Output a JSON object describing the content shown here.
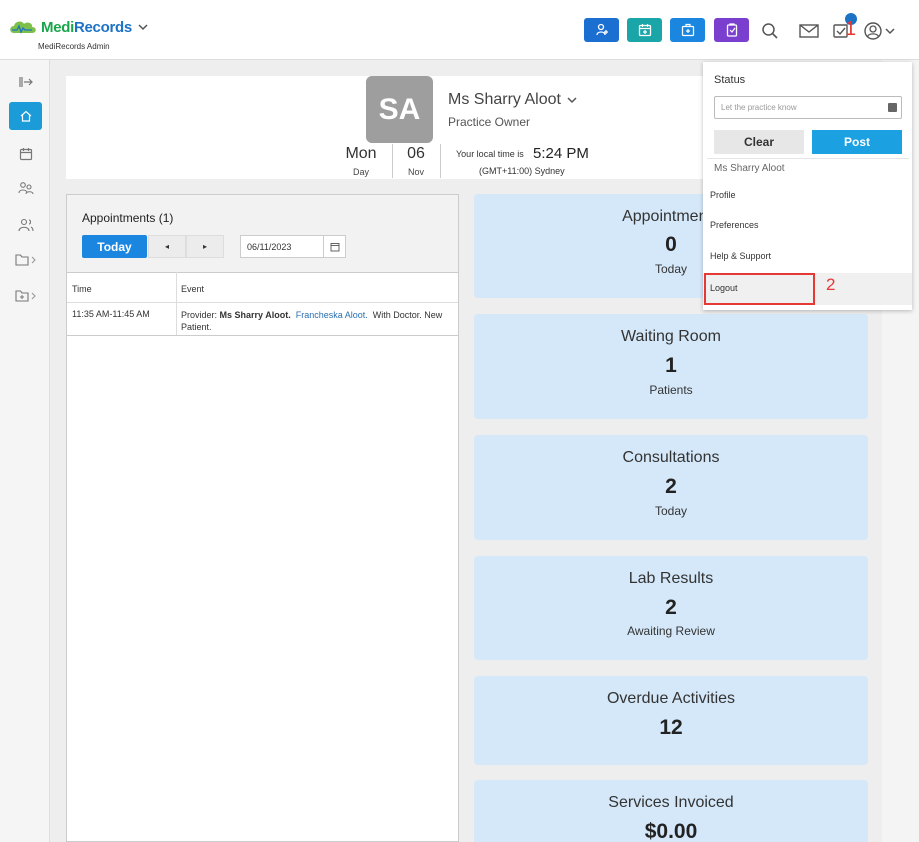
{
  "header": {
    "logo_main": "Medi",
    "logo_accent": "Records",
    "logo_sub": "MediRecords Admin",
    "annotation_1": "1"
  },
  "profile": {
    "initials": "SA",
    "name": "Ms Sharry Aloot",
    "role": "Practice Owner",
    "day_name": "Mon",
    "day_label": "Day",
    "day_num": "06",
    "month_label": "Nov",
    "time_label": "Your local time is",
    "time": "5:24 PM",
    "timezone": "(GMT+11:00) Sydney"
  },
  "appointments": {
    "title": "Appointments (1)",
    "today_label": "Today",
    "prev_glyph": "◂",
    "next_glyph": "▸",
    "date_value": "06/11/2023",
    "col_time": "Time",
    "col_event": "Event",
    "rows": [
      {
        "time": "11:35 AM-11:45 AM",
        "provider_prefix": "Provider: ",
        "provider": "Ms Sharry Aloot.",
        "patient": "Francheska Aloot.",
        "detail": "With Doctor. New Patient."
      }
    ]
  },
  "stats": [
    {
      "title": "Appointments",
      "value": "0",
      "sub": "Today"
    },
    {
      "title": "Waiting Room",
      "value": "1",
      "sub": "Patients"
    },
    {
      "title": "Consultations",
      "value": "2",
      "sub": "Today"
    },
    {
      "title": "Lab Results",
      "value": "2",
      "sub": "Awaiting Review"
    },
    {
      "title": "Overdue Activities",
      "value": "12",
      "sub": ""
    },
    {
      "title": "Services Invoiced",
      "value": "$0.00",
      "sub": ""
    }
  ],
  "dropdown": {
    "status_label": "Status",
    "status_placeholder": "Let the practice know",
    "clear_label": "Clear",
    "post_label": "Post",
    "user_name": "Ms Sharry Aloot",
    "items": [
      "Profile",
      "Preferences",
      "Help & Support",
      "Logout"
    ],
    "annotation_2": "2"
  },
  "colors": {
    "accent_blue": "#1b86e0",
    "teal": "#1aa5a8",
    "purple": "#7b3fd0",
    "card_bg": "#d5e8f9",
    "highlight_red": "#e53935"
  }
}
